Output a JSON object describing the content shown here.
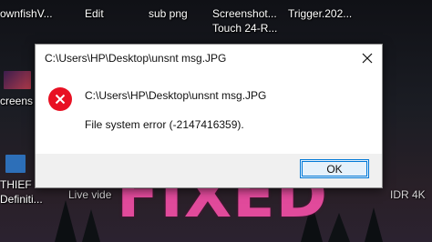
{
  "desktop": {
    "icons": [
      {
        "label": "ownfishV...",
        "name": "desktop-icon-ownfishv"
      },
      {
        "label": "Edit",
        "name": "desktop-icon-edit"
      },
      {
        "label": "sub png",
        "name": "desktop-icon-sub-png"
      },
      {
        "label": "Screenshot...",
        "name": "desktop-icon-screenshot"
      },
      {
        "label": "Touch 24-R...",
        "name": "desktop-icon-touch"
      },
      {
        "label": "Trigger.202...",
        "name": "desktop-icon-trigger"
      }
    ],
    "left_labels": [
      "creens",
      "THIEF",
      "Definiti..."
    ],
    "bottom_right_label": "IDR 4K",
    "bottom_left_label": "Live vide"
  },
  "dialog": {
    "title": "C:\\Users\\HP\\Desktop\\unsnt msg.JPG",
    "message_path": "C:\\Users\\HP\\Desktop\\unsnt msg.JPG",
    "message_error": "File system error (-2147416359).",
    "ok_label": "OK",
    "icon": "error-icon"
  },
  "overlay": {
    "text": "FIXED",
    "color": "#e14a9b"
  }
}
